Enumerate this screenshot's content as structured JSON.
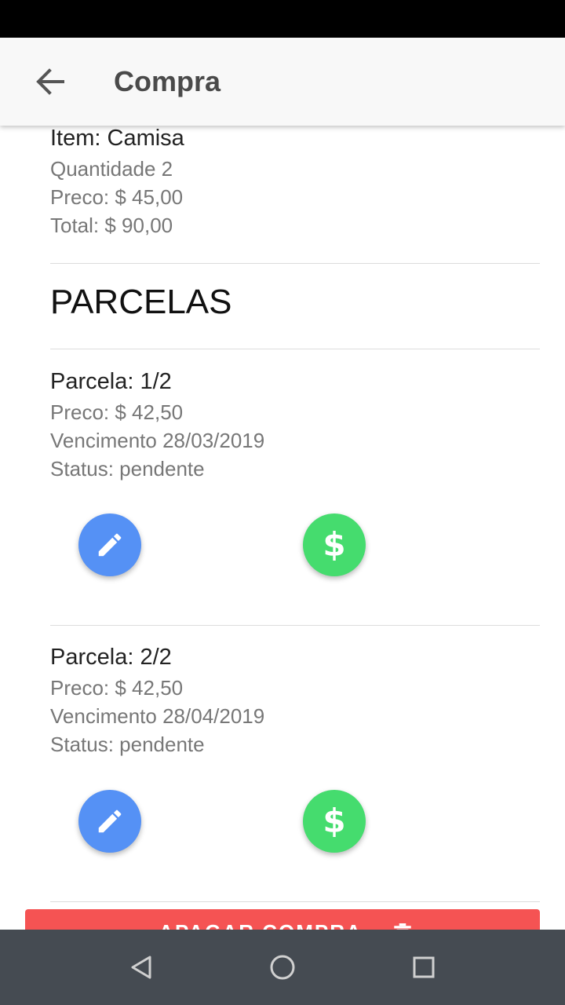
{
  "app_bar": {
    "title": "Compra",
    "back_icon": "arrow-left-icon"
  },
  "purchase": {
    "item": "Item: Camisa",
    "quantity": "Quantidade 2",
    "price": "Preco: $ 45,00",
    "total": "Total: $ 90,00"
  },
  "section_title": "PARCELAS",
  "installments": [
    {
      "label": "Parcela: 1/2",
      "price": "Preco: $ 42,50",
      "due": "Vencimento 28/03/2019",
      "status": "Status: pendente",
      "edit_icon": "pencil-icon",
      "pay_icon": "dollar-icon",
      "pay_symbol": "$"
    },
    {
      "label": "Parcela: 2/2",
      "price": "Preco: $ 42,50",
      "due": "Vencimento 28/04/2019",
      "status": "Status: pendente",
      "edit_icon": "pencil-icon",
      "pay_icon": "dollar-icon",
      "pay_symbol": "$"
    }
  ],
  "delete_button": {
    "label": "APAGAR COMPRA",
    "icon": "trash-icon"
  },
  "nav_bar": {
    "icons": [
      "back-triangle-icon",
      "home-circle-icon",
      "recents-square-icon"
    ]
  },
  "colors": {
    "edit": "#5591f5",
    "pay": "#45dc6e",
    "delete": "#f55353",
    "app_bar": "#f8f8f8",
    "nav_bar": "#454b52"
  }
}
